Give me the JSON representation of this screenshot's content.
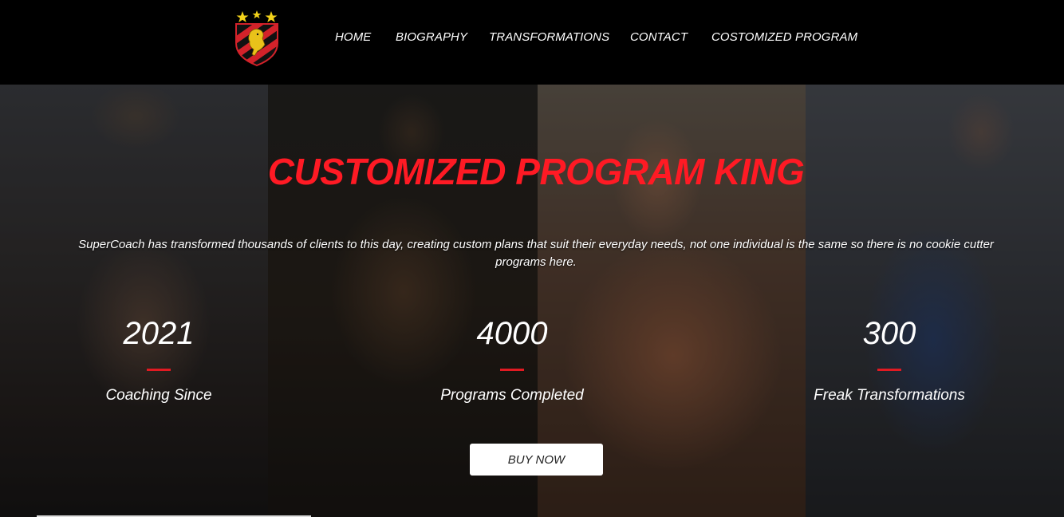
{
  "header": {
    "logo_icon": "lion-crest-shield-icon",
    "nav": [
      {
        "label": "HOME"
      },
      {
        "label": "BIOGRAPHY"
      },
      {
        "label": "TRANSFORMATIONS"
      },
      {
        "label": "CONTACT"
      },
      {
        "label": "COSTOMIZED PROGRAM"
      }
    ]
  },
  "hero": {
    "title": "CUSTOMIZED PROGRAM KING",
    "description": "SuperCoach has transformed thousands of clients to this day, creating custom plans that suit their everyday needs, not one individual is the same so there is no cookie cutter programs here.",
    "stats": [
      {
        "value": "2021",
        "label": "Coaching Since"
      },
      {
        "value": "4000",
        "label": "Programs Completed"
      },
      {
        "value": "300",
        "label": "Freak Transformations"
      }
    ],
    "button_label": "BUY NOW"
  },
  "colors": {
    "accent_red": "#ff1a24",
    "header_bg": "#000000",
    "button_bg": "#ffffff"
  }
}
